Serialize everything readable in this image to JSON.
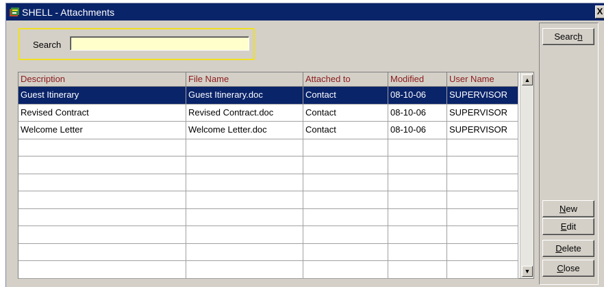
{
  "window": {
    "title": "SHELL - Attachments",
    "close_glyph": "X",
    "icon": "app-icon"
  },
  "search": {
    "label": "Search",
    "value": "",
    "placeholder": ""
  },
  "table": {
    "columns": [
      "Description",
      "File Name",
      "Attached to",
      "Modified",
      "User Name"
    ],
    "rows": [
      {
        "description": "Guest Itinerary",
        "file_name": "Guest Itinerary.doc",
        "attached_to": "Contact",
        "modified": "08-10-06",
        "user_name": "SUPERVISOR",
        "selected": true
      },
      {
        "description": "Revised Contract",
        "file_name": "Revised Contract.doc",
        "attached_to": "Contact",
        "modified": "08-10-06",
        "user_name": "SUPERVISOR",
        "selected": false
      },
      {
        "description": "Welcome Letter",
        "file_name": "Welcome Letter.doc",
        "attached_to": "Contact",
        "modified": "08-10-06",
        "user_name": "SUPERVISOR",
        "selected": false
      }
    ],
    "empty_rows": 8
  },
  "buttons": {
    "search": {
      "before": "Searc",
      "mnemonic": "h",
      "after": ""
    },
    "new": {
      "before": "",
      "mnemonic": "N",
      "after": "ew"
    },
    "edit": {
      "before": "",
      "mnemonic": "E",
      "after": "dit"
    },
    "delete": {
      "before": "",
      "mnemonic": "D",
      "after": "elete"
    },
    "close": {
      "before": "",
      "mnemonic": "C",
      "after": "lose"
    }
  },
  "colors": {
    "title_bar": "#0a246a",
    "selection": "#0a246a",
    "header_text": "#8b1a1a",
    "search_highlight": "#f0e020",
    "input_bg": "#ffffcc"
  }
}
